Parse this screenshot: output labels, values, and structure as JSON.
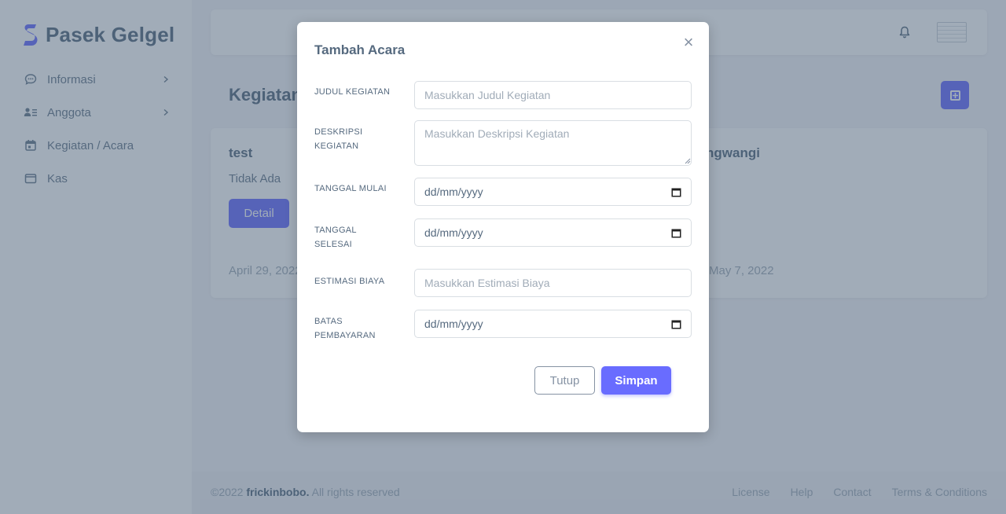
{
  "brand": {
    "name": "Pasek Gelgel",
    "logo_icon": "brand-s-logo"
  },
  "sidebar": {
    "items": [
      {
        "label": "Informasi",
        "icon": "chat-icon",
        "has_submenu": true
      },
      {
        "label": "Anggota",
        "icon": "user-list-icon",
        "has_submenu": true
      },
      {
        "label": "Kegiatan / Acara",
        "icon": "calendar-icon",
        "has_submenu": false
      },
      {
        "label": "Kas",
        "icon": "wallet-icon",
        "has_submenu": false
      }
    ]
  },
  "topbar": {
    "notification_icon": "bell-icon",
    "avatar_icon": "avatar"
  },
  "page": {
    "title": "Kegiatan"
  },
  "cards": [
    {
      "title": "test",
      "description": "Tidak Ada",
      "button_label": "Detail",
      "date": "April 29, 2022"
    },
    {
      "title": "ngwangi",
      "date": "May 7, 2022"
    }
  ],
  "footer": {
    "copyright_prefix": "©2022 ",
    "copyright_brand": "frickinbobo.",
    "copyright_suffix": " All rights reserved",
    "links": [
      "License",
      "Help",
      "Contact",
      "Terms & Conditions"
    ]
  },
  "modal": {
    "title": "Tambah Acara",
    "close_label": "×",
    "fields": {
      "judul": {
        "label": "JUDUL KEGIATAN",
        "placeholder": "Masukkan Judul Kegiatan"
      },
      "deskripsi": {
        "label": "DESKRIPSI KEGIATAN",
        "placeholder": "Masukkan Deskripsi Kegiatan"
      },
      "tanggal_mulai": {
        "label": "TANGGAL MULAI",
        "value": "dd/mm/yyyy"
      },
      "tanggal_selesai": {
        "label": "TANGGAL SELESAI",
        "value": "dd/mm/yyyy"
      },
      "estimasi_biaya": {
        "label": "ESTIMASI BIAYA",
        "placeholder": "Masukkan Estimasi Biaya"
      },
      "batas_pembayaran": {
        "label": "BATAS PEMBAYARAN",
        "value": "dd/mm/yyyy"
      }
    },
    "buttons": {
      "close": "Tutup",
      "save": "Simpan"
    }
  },
  "colors": {
    "primary": "#696cff",
    "text": "#566a7f",
    "muted": "#a1acb8",
    "backdrop": "#435971"
  }
}
